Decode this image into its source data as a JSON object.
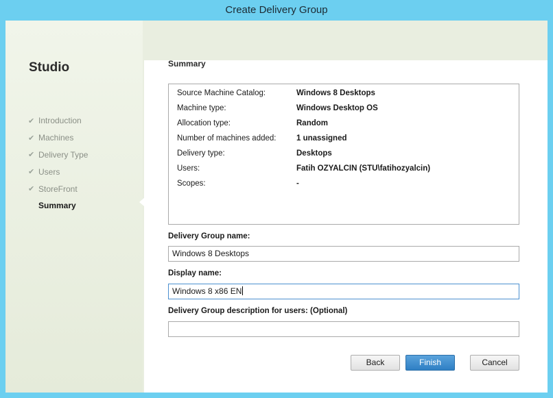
{
  "window": {
    "title": "Create Delivery Group"
  },
  "sidebar": {
    "title": "Studio",
    "steps": [
      {
        "label": "Introduction",
        "done": true
      },
      {
        "label": "Machines",
        "done": true
      },
      {
        "label": "Delivery Type",
        "done": true
      },
      {
        "label": "Users",
        "done": true
      },
      {
        "label": "StoreFront",
        "done": true
      },
      {
        "label": "Summary",
        "done": false,
        "current": true
      }
    ]
  },
  "main": {
    "header": "Summary",
    "summary": [
      {
        "label": "Source Machine Catalog:",
        "value": "Windows 8 Desktops"
      },
      {
        "label": "Machine type:",
        "value": "Windows Desktop OS"
      },
      {
        "label": "Allocation type:",
        "value": "Random"
      },
      {
        "label": "Number of machines added:",
        "value": "1 unassigned"
      },
      {
        "label": "Delivery type:",
        "value": "Desktops"
      },
      {
        "label": "Users:",
        "value": "Fatih OZYALCIN (STU\\fatihozyalcin)"
      },
      {
        "label": "Scopes:",
        "value": "-"
      }
    ],
    "fields": {
      "group_name": {
        "label": "Delivery Group name:",
        "value": "Windows 8 Desktops"
      },
      "display_name": {
        "label": "Display name:",
        "value": "Windows 8 x86 EN"
      },
      "description": {
        "label": "Delivery Group description for users: (Optional)",
        "value": ""
      }
    }
  },
  "buttons": {
    "back": "Back",
    "finish": "Finish",
    "cancel": "Cancel"
  },
  "colors": {
    "titlebar": "#6ccff0",
    "primary_button": "#3a8acc",
    "sidebar_bg": "#e9eee0"
  },
  "icons": {
    "step_done": "check-icon"
  }
}
